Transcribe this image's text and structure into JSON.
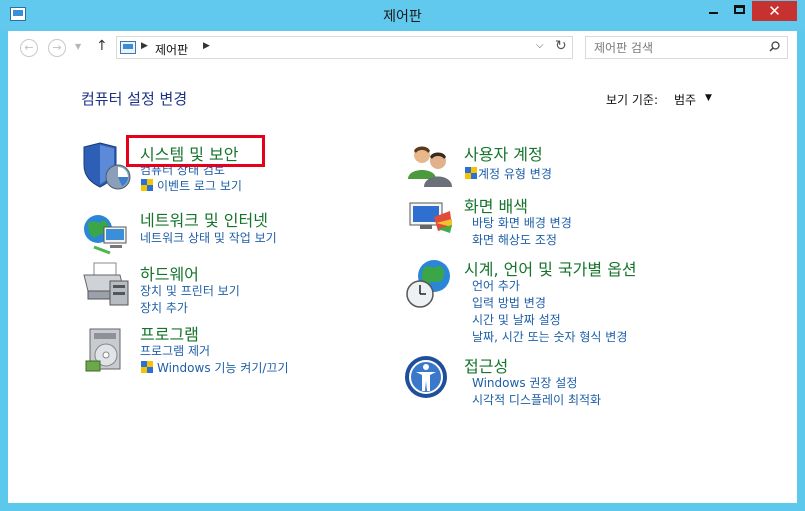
{
  "window": {
    "title": "제어판"
  },
  "toolbar": {
    "address_path": "제어판",
    "search_placeholder": "제어판 검색"
  },
  "header": {
    "page_title": "컴퓨터 설정 변경",
    "view_by_label": "보기 기준:",
    "view_by_value": "범주"
  },
  "categories_left": [
    {
      "title": "시스템 및 보안",
      "links": [
        "컴퓨터 상태 검토",
        "이벤트 로그 보기"
      ],
      "icon": "shield-icon"
    },
    {
      "title": "네트워크 및 인터넷",
      "links": [
        "네트워크 상태 및 작업 보기"
      ],
      "icon": "network-icon"
    },
    {
      "title": "하드웨어",
      "links": [
        "장치 및 프린터 보기",
        "장치 추가"
      ],
      "icon": "printer-icon"
    },
    {
      "title": "프로그램",
      "links": [
        "프로그램 제거",
        "Windows 기능 켜기/끄기"
      ],
      "icon": "programs-icon"
    }
  ],
  "categories_right": [
    {
      "title": "사용자 계정",
      "links": [
        "계정 유형 변경"
      ],
      "icon": "users-icon"
    },
    {
      "title": "화면 배색",
      "links": [
        "바탕 화면 배경 변경",
        "화면 해상도 조정"
      ],
      "icon": "display-icon"
    },
    {
      "title": "시계, 언어 및 국가별 옵션",
      "links": [
        "언어 추가",
        "입력 방법 변경",
        "시간 및 날짜 설정",
        "날짜, 시간 또는 숫자 형식 변경"
      ],
      "icon": "clock-globe-icon"
    },
    {
      "title": "접근성",
      "links": [
        "Windows 권장 설정",
        "시각적 디스플레이 최적화"
      ],
      "icon": "accessibility-icon"
    }
  ],
  "colors": {
    "title_bar": "#62c9ee",
    "close_button": "#c7312f",
    "category_title": "#16742c",
    "link": "#1e5fa8",
    "highlight_box": "#e8001a"
  }
}
